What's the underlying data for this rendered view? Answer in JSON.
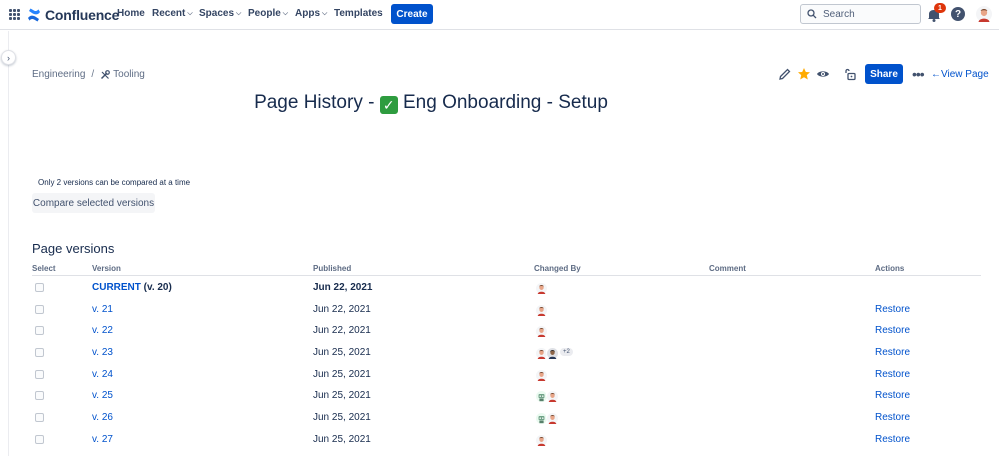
{
  "nav": {
    "logo": "Confluence",
    "items": [
      {
        "label": "Home",
        "dropdown": false
      },
      {
        "label": "Recent",
        "dropdown": true
      },
      {
        "label": "Spaces",
        "dropdown": true
      },
      {
        "label": "People",
        "dropdown": true
      },
      {
        "label": "Apps",
        "dropdown": true
      },
      {
        "label": "Templates",
        "dropdown": false
      }
    ],
    "create_label": "Create",
    "search_placeholder": "Search",
    "notification_count": "1",
    "help_label": "?"
  },
  "breadcrumb": {
    "space": "Engineering",
    "parent": "Tooling"
  },
  "actions": {
    "share_label": "Share",
    "view_page_label": "View Page",
    "more_label": "•••"
  },
  "page": {
    "title_prefix": "Page History - ",
    "title_emoji": "✓",
    "title_suffix": " Eng Onboarding - Setup",
    "compare_note": "Only 2 versions can be compared at a time",
    "compare_button": "Compare selected versions",
    "section_title": "Page versions"
  },
  "table": {
    "headers": {
      "select": "Select",
      "version": "Version",
      "published": "Published",
      "changed_by": "Changed By",
      "comment": "Comment",
      "actions": "Actions"
    },
    "rows": [
      {
        "version": "CURRENT",
        "version_suffix": " (v. 20)",
        "published": "Jun 22, 2021",
        "avatars": [
          "person"
        ],
        "extra": "",
        "restore": ""
      },
      {
        "version": "v. 21",
        "version_suffix": "",
        "published": "Jun 22, 2021",
        "avatars": [
          "person"
        ],
        "extra": "",
        "restore": "Restore"
      },
      {
        "version": "v. 22",
        "version_suffix": "",
        "published": "Jun 22, 2021",
        "avatars": [
          "person"
        ],
        "extra": "",
        "restore": "Restore"
      },
      {
        "version": "v. 23",
        "version_suffix": "",
        "published": "Jun 25, 2021",
        "avatars": [
          "person",
          "dark"
        ],
        "extra": "+2",
        "restore": "Restore"
      },
      {
        "version": "v. 24",
        "version_suffix": "",
        "published": "Jun 25, 2021",
        "avatars": [
          "person"
        ],
        "extra": "",
        "restore": "Restore"
      },
      {
        "version": "v. 25",
        "version_suffix": "",
        "published": "Jun 25, 2021",
        "avatars": [
          "robot",
          "person"
        ],
        "extra": "",
        "restore": "Restore"
      },
      {
        "version": "v. 26",
        "version_suffix": "",
        "published": "Jun 25, 2021",
        "avatars": [
          "robot",
          "person"
        ],
        "extra": "",
        "restore": "Restore"
      },
      {
        "version": "v. 27",
        "version_suffix": "",
        "published": "Jun 25, 2021",
        "avatars": [
          "person"
        ],
        "extra": "",
        "restore": "Restore"
      }
    ]
  },
  "colors": {
    "brand": "#0052cc",
    "text": "#172b4d",
    "badge": "#de350b",
    "star": "#ffab00"
  }
}
